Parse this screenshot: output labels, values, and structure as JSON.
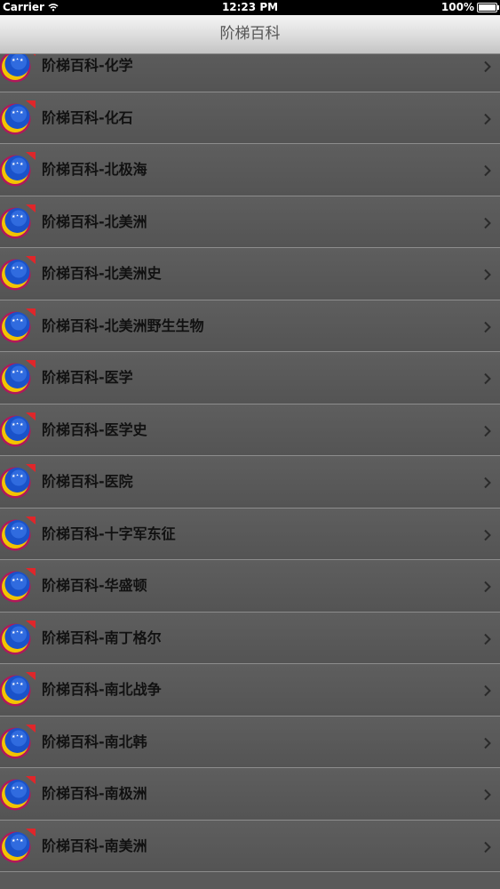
{
  "status": {
    "carrier": "Carrier",
    "time": "12:23 PM",
    "battery": "100%"
  },
  "nav": {
    "title": "阶梯百科"
  },
  "rows": [
    {
      "label": "阶梯百科-化学"
    },
    {
      "label": "阶梯百科-化石"
    },
    {
      "label": "阶梯百科-北极海"
    },
    {
      "label": "阶梯百科-北美洲"
    },
    {
      "label": "阶梯百科-北美洲史"
    },
    {
      "label": "阶梯百科-北美洲野生生物"
    },
    {
      "label": "阶梯百科-医学"
    },
    {
      "label": "阶梯百科-医学史"
    },
    {
      "label": "阶梯百科-医院"
    },
    {
      "label": "阶梯百科-十字军东征"
    },
    {
      "label": "阶梯百科-华盛顿"
    },
    {
      "label": "阶梯百科-南丁格尔"
    },
    {
      "label": "阶梯百科-南北战争"
    },
    {
      "label": "阶梯百科-南北韩"
    },
    {
      "label": "阶梯百科-南极洲"
    },
    {
      "label": "阶梯百科-南美洲"
    }
  ],
  "icons": {
    "row_icon": "app-logo-icon",
    "disclosure": "chevron-right-icon"
  }
}
